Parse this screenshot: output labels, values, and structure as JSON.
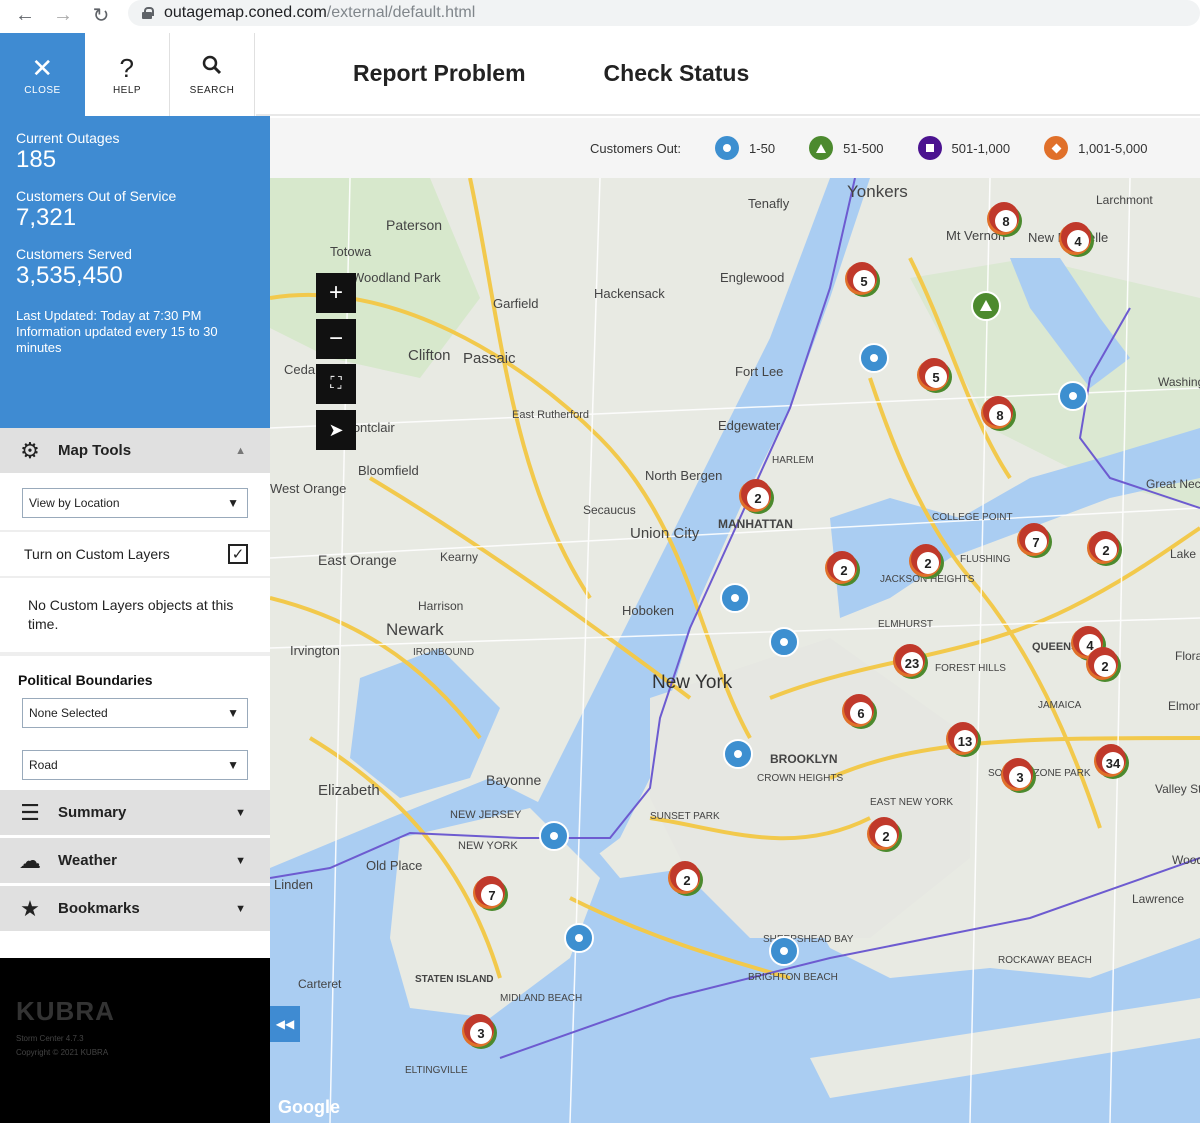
{
  "browser": {
    "url_host": "outagemap.coned.com",
    "url_path": "/external/default.html"
  },
  "toolbar": {
    "close_label": "CLOSE",
    "help_label": "HELP",
    "search_label": "SEARCH"
  },
  "header": {
    "report_problem": "Report Problem",
    "check_status": "Check Status"
  },
  "stats": {
    "current_outages_label": "Current Outages",
    "current_outages_value": "185",
    "customers_out_label": "Customers Out of Service",
    "customers_out_value": "7,321",
    "customers_served_label": "Customers Served",
    "customers_served_value": "3,535,450",
    "last_updated": "Last Updated: Today at 7:30 PM",
    "update_frequency": "Information updated every 15 to 30 minutes"
  },
  "map_tools": {
    "title": "Map Tools",
    "view_select": "View by Location",
    "custom_layers_label": "Turn on Custom Layers",
    "custom_layers_checked": true,
    "no_layers_note": "No Custom Layers objects at this time."
  },
  "political": {
    "title": "Political Boundaries",
    "boundary_select": "None Selected",
    "map_type_select": "Road"
  },
  "sections": {
    "summary": "Summary",
    "weather": "Weather",
    "bookmarks": "Bookmarks"
  },
  "branding": {
    "logo_text": "KUBRA",
    "version": "Storm Center 4.7.3",
    "copyright": "Copyright © 2021 KUBRA"
  },
  "legend": {
    "title": "Customers Out:",
    "items": [
      {
        "label": "1-50",
        "color": "#3d8fd0",
        "shape": "circle"
      },
      {
        "label": "51-500",
        "color": "#4c8a2e",
        "shape": "triangle"
      },
      {
        "label": "501-1,000",
        "color": "#4b1390",
        "shape": "square"
      },
      {
        "label": "1,001-5,000",
        "color": "#e0702a",
        "shape": "diamond"
      }
    ]
  },
  "map": {
    "attribution": "Google",
    "place_labels": [
      "Yonkers",
      "Paterson",
      "Totowa",
      "Woodland Park",
      "Garfield",
      "Hackensack",
      "Englewood",
      "Tenafly",
      "Clifton",
      "Passaic",
      "East Rutherford",
      "Fort Lee",
      "Edgewater",
      "Cedar",
      "Montclair",
      "Bloomfield",
      "West Orange",
      "East Orange",
      "Kearny",
      "North Bergen",
      "Secaucus",
      "Union City",
      "MANHATTAN",
      "HARLEM",
      "Hoboken",
      "Harrison",
      "Newark",
      "IRONBOUND",
      "Irvington",
      "New York",
      "Bayonne",
      "Elizabeth",
      "NEW JERSEY",
      "NEW YORK",
      "BROOKLYN",
      "CROWN HEIGHTS",
      "SUNSET PARK",
      "EAST NEW YORK",
      "Linden",
      "Old Place",
      "STATEN ISLAND",
      "MIDLAND BEACH",
      "Carteret",
      "ELTINGVILLE",
      "BRIGHTON BEACH",
      "SHEEPSHEAD BAY",
      "COLLEGE POINT",
      "FLUSHING",
      "JACKSON HEIGHTS",
      "ELMHURST",
      "QUEENS",
      "FOREST HILLS",
      "JAMAICA",
      "SOUTH OZONE PARK",
      "Mt Vernon",
      "New Rochelle",
      "Larchmont",
      "Great Neck",
      "Lake Success",
      "Floral Park",
      "Elmont",
      "Valley Stream",
      "Woodmere",
      "Lawrence",
      "ROCKAWAY BEACH",
      "Washington"
    ],
    "outage_clusters": [
      {
        "count": "2"
      },
      {
        "count": "5"
      },
      {
        "count": "5"
      },
      {
        "count": "8"
      },
      {
        "count": "8"
      },
      {
        "count": "4"
      },
      {
        "count": "2"
      },
      {
        "count": "2"
      },
      {
        "count": "7"
      },
      {
        "count": "2"
      },
      {
        "count": "4"
      },
      {
        "count": "2"
      },
      {
        "count": "23"
      },
      {
        "count": "6"
      },
      {
        "count": "13"
      },
      {
        "count": "3"
      },
      {
        "count": "34"
      },
      {
        "count": "2"
      },
      {
        "count": "2"
      },
      {
        "count": "7"
      },
      {
        "count": "3"
      }
    ]
  }
}
